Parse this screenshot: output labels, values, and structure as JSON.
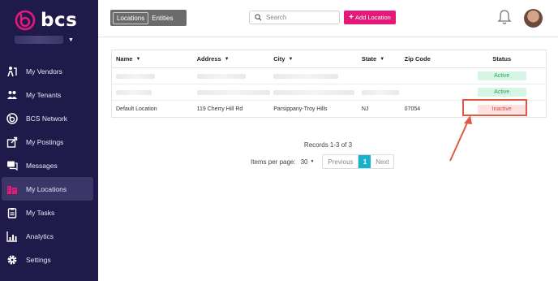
{
  "app": {
    "brand": "bcs"
  },
  "sidebar": {
    "items": [
      {
        "label": "My Vendors",
        "icon": "vendors-icon"
      },
      {
        "label": "My Tenants",
        "icon": "tenants-icon"
      },
      {
        "label": "BCS Network",
        "icon": "network-icon"
      },
      {
        "label": "My Postings",
        "icon": "postings-icon"
      },
      {
        "label": "Messages",
        "icon": "messages-icon"
      },
      {
        "label": "My Locations",
        "icon": "locations-icon",
        "active": true
      },
      {
        "label": "My Tasks",
        "icon": "tasks-icon"
      },
      {
        "label": "Analytics",
        "icon": "analytics-icon"
      },
      {
        "label": "Settings",
        "icon": "settings-icon"
      }
    ]
  },
  "topbar": {
    "tabs": [
      "Locations",
      "Entities"
    ],
    "search_placeholder": "Search",
    "add_label": "Add Location"
  },
  "table": {
    "headers": [
      "Name",
      "Address",
      "City",
      "State",
      "Zip Code",
      "Status"
    ],
    "rows": [
      {
        "name": "",
        "address": "",
        "city": "",
        "state": "",
        "zip": "",
        "status": "Active"
      },
      {
        "name": "",
        "address": "",
        "city": "",
        "state": "",
        "zip": "",
        "status": "Active"
      },
      {
        "name": "Default Location",
        "address": "119 Cherry Hill Rd",
        "city": "Parsippany-Troy Hills",
        "state": "NJ",
        "zip": "07054",
        "status": "Inactive"
      }
    ]
  },
  "pagination": {
    "records_text": "Records 1-3 of 3",
    "items_per_page_label": "Items per page:",
    "items_per_page_value": "30",
    "prev_label": "Previous",
    "current_page": "1",
    "next_label": "Next"
  },
  "colors": {
    "sidebar_bg": "#1f1a4a",
    "brand_pink": "#e4197a",
    "active_green": "#29a35b",
    "inactive_red": "#e04545",
    "page_teal": "#17b2c9",
    "annotation": "#e05a43"
  }
}
